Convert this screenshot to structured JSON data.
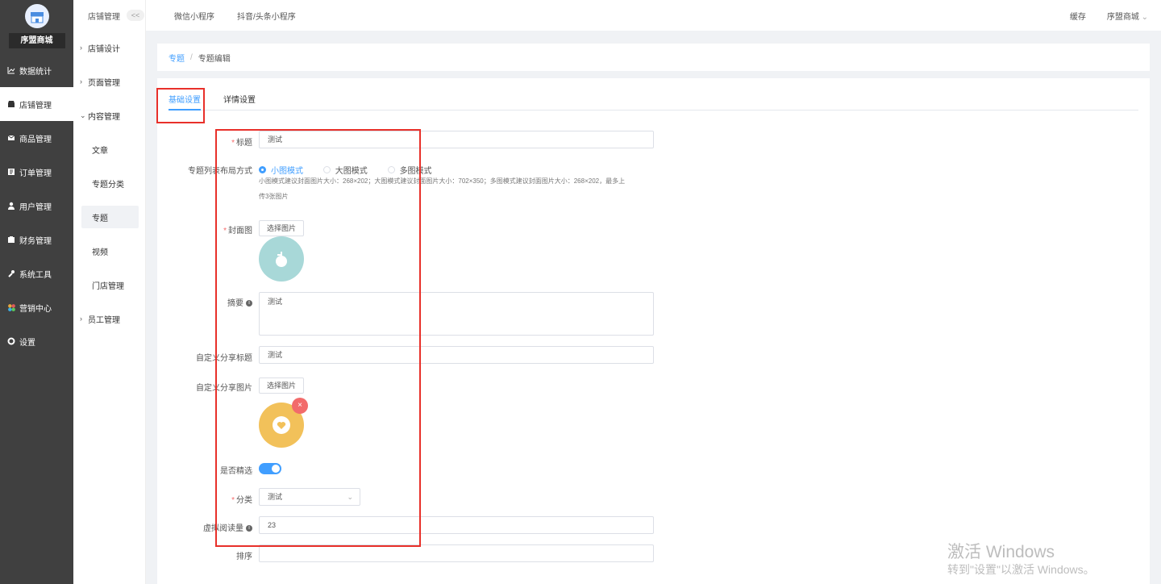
{
  "sidebar": {
    "shop_name": "序盟商城",
    "items": [
      {
        "label": "数据统计",
        "icon": "chart-line-icon"
      },
      {
        "label": "店铺管理",
        "icon": "store-icon"
      },
      {
        "label": "商品管理",
        "icon": "mail-icon"
      },
      {
        "label": "订单管理",
        "icon": "order-icon"
      },
      {
        "label": "用户管理",
        "icon": "user-icon"
      },
      {
        "label": "财务管理",
        "icon": "finance-icon"
      },
      {
        "label": "系统工具",
        "icon": "wrench-icon"
      },
      {
        "label": "营销中心",
        "icon": "marketing-icon"
      },
      {
        "label": "设置",
        "icon": "gear-icon"
      }
    ]
  },
  "subnav": {
    "title": "店铺管理",
    "collapse": "<<",
    "groups": [
      {
        "label": "店铺设计"
      },
      {
        "label": "页面管理"
      },
      {
        "label": "内容管理"
      }
    ],
    "content_items": [
      "文章",
      "专题分类",
      "专题",
      "视频",
      "门店管理"
    ],
    "staff_group": "员工管理"
  },
  "header": {
    "tab1": "微信小程序",
    "tab2": "抖音/头条小程序",
    "cache": "缓存",
    "shop": "序盟商城"
  },
  "breadcrumb": {
    "parent": "专题",
    "sep": "/",
    "current": "专题编辑"
  },
  "tabs": {
    "basic": "基础设置",
    "detail": "详情设置"
  },
  "form": {
    "title_label": "标题",
    "title_value": "测试",
    "layout_label": "专题列表布局方式",
    "layout_options": [
      "小图模式",
      "大图模式",
      "多图模式"
    ],
    "layout_hint_line1": "小图模式建议封面图片大小：268×202；大图模式建议封面图片大小：702×350；多图模式建议封面图片大小：268×202，最多上",
    "layout_hint_line2": "传3张图片",
    "cover_label": "封面图",
    "choose_image": "选择图片",
    "summary_label": "摘要",
    "summary_value": "测试",
    "share_title_label": "自定义分享标题",
    "share_title_value": "测试",
    "share_image_label": "自定义分享图片",
    "featured_label": "是否精选",
    "category_label": "分类",
    "category_value": "测试",
    "views_label": "虚拟阅读量",
    "views_value": "23",
    "sort_label": "排序",
    "sort_value": ""
  },
  "watermark": {
    "line1": "激活 Windows",
    "line2": "转到\"设置\"以激活 Windows。"
  },
  "colors": {
    "accent": "#409eff",
    "sidebar_bg": "#404040",
    "highlight_red": "#e8302a",
    "cover_teal": "#a8d8d8",
    "share_yellow": "#f2c15a"
  }
}
